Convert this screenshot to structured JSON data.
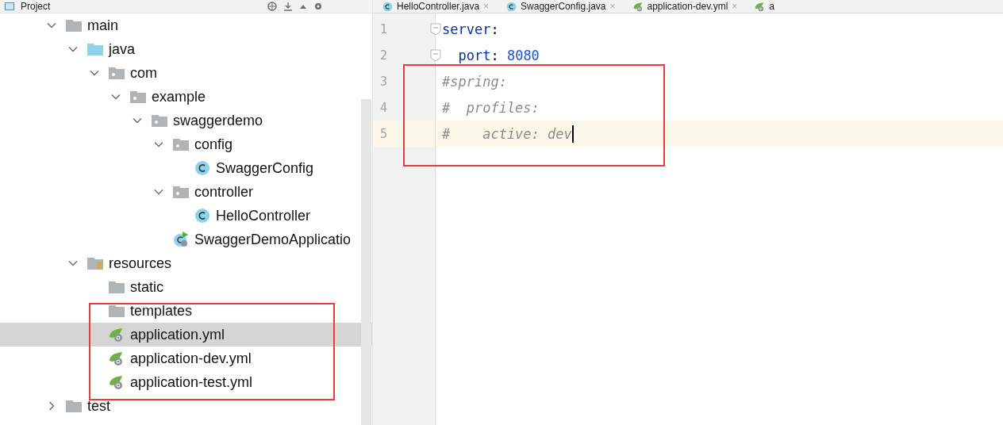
{
  "project_bar": {
    "title": "Project"
  },
  "tree": [
    {
      "label": "main",
      "kind": "folder",
      "expanded": true,
      "selected": false,
      "children": [
        {
          "label": "java",
          "kind": "source-folder",
          "expanded": true,
          "selected": false,
          "children": [
            {
              "label": "com",
              "kind": "package",
              "expanded": true,
              "selected": false,
              "children": [
                {
                  "label": "example",
                  "kind": "package",
                  "expanded": true,
                  "selected": false,
                  "children": [
                    {
                      "label": "swaggerdemo",
                      "kind": "package",
                      "expanded": true,
                      "selected": false,
                      "children": [
                        {
                          "label": "config",
                          "kind": "package",
                          "expanded": true,
                          "selected": false,
                          "children": [
                            {
                              "label": "SwaggerConfig",
                              "kind": "class",
                              "selected": false
                            }
                          ]
                        },
                        {
                          "label": "controller",
                          "kind": "package",
                          "expanded": true,
                          "selected": false,
                          "children": [
                            {
                              "label": "HelloController",
                              "kind": "class",
                              "selected": false
                            }
                          ]
                        },
                        {
                          "label": "SwaggerDemoApplicatio",
                          "kind": "app-class",
                          "selected": false
                        }
                      ]
                    }
                  ]
                }
              ]
            }
          ]
        },
        {
          "label": "resources",
          "kind": "resource-folder",
          "expanded": true,
          "selected": false,
          "children": [
            {
              "label": "static",
              "kind": "folder",
              "selected": false
            },
            {
              "label": "templates",
              "kind": "folder",
              "selected": false
            },
            {
              "label": "application.yml",
              "kind": "yml",
              "selected": true
            },
            {
              "label": "application-dev.yml",
              "kind": "yml",
              "selected": false
            },
            {
              "label": "application-test.yml",
              "kind": "yml",
              "selected": false
            }
          ]
        }
      ]
    },
    {
      "label": "test",
      "kind": "folder",
      "expanded": false,
      "selected": false
    }
  ],
  "editor_tabs": [
    {
      "label": "HelloController.java",
      "kind": "class",
      "selected": false,
      "close": "×"
    },
    {
      "label": "SwaggerConfig.java",
      "kind": "class",
      "selected": false,
      "close": "×"
    },
    {
      "label": "application-dev.yml",
      "kind": "yml",
      "selected": false,
      "close": "×"
    },
    {
      "label": "a",
      "kind": "yml",
      "selected": false
    }
  ],
  "code_lines": [
    {
      "number": "1",
      "fold": true,
      "current": false,
      "tokens": [
        {
          "kind": "key",
          "text": "server"
        },
        {
          "kind": "punct",
          "text": ":"
        }
      ]
    },
    {
      "number": "2",
      "fold": true,
      "current": false,
      "tokens": [
        {
          "kind": "key",
          "text": "  port"
        },
        {
          "kind": "punct",
          "text": ": "
        },
        {
          "kind": "number",
          "text": "8080"
        }
      ]
    },
    {
      "number": "3",
      "fold": false,
      "current": false,
      "tokens": [
        {
          "kind": "comment",
          "text": "#spring:"
        }
      ]
    },
    {
      "number": "4",
      "fold": false,
      "current": false,
      "tokens": [
        {
          "kind": "comment",
          "text": "#  profiles:"
        }
      ]
    },
    {
      "number": "5",
      "fold": false,
      "current": true,
      "tokens": [
        {
          "kind": "comment",
          "text": "#    active: dev"
        }
      ]
    }
  ]
}
